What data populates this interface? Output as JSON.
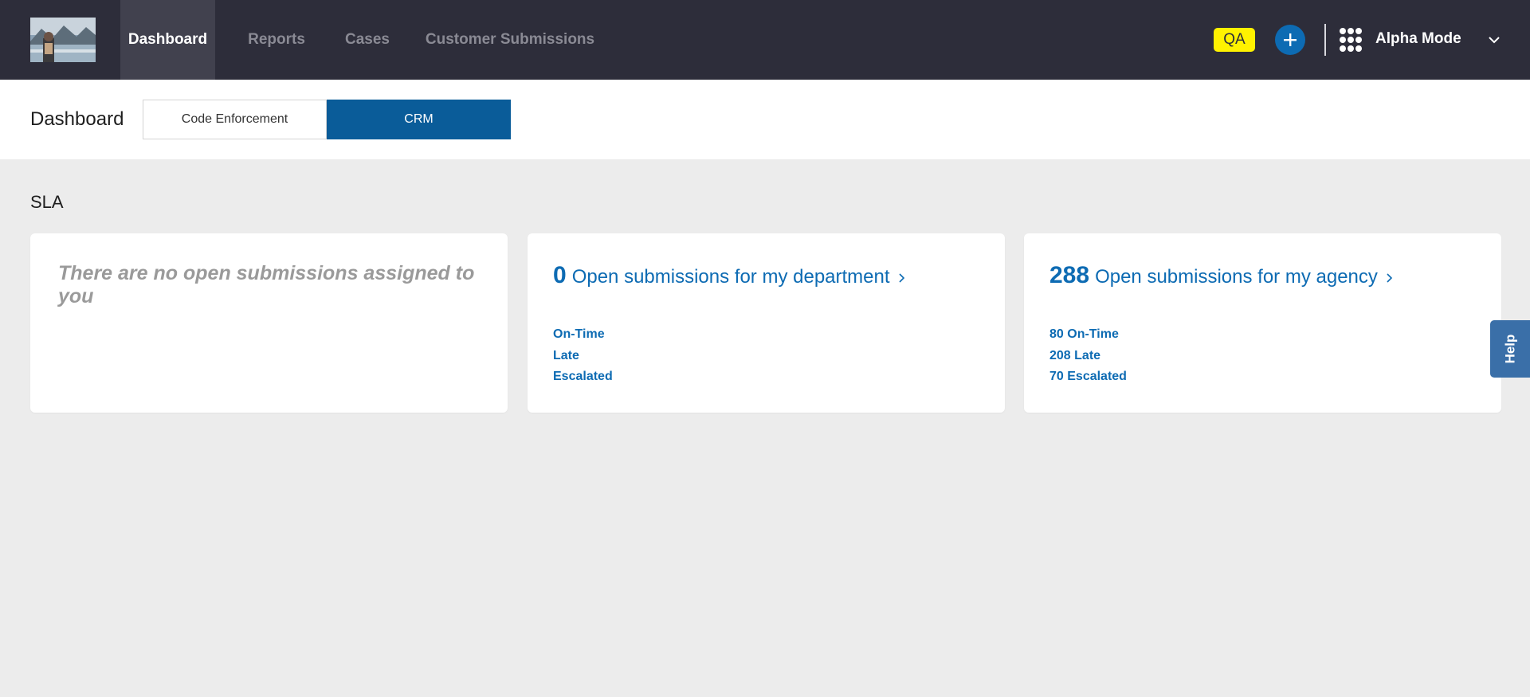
{
  "nav": {
    "tabs": [
      {
        "label": "Dashboard",
        "active": true
      },
      {
        "label": "Reports",
        "active": false
      },
      {
        "label": "Cases",
        "active": false
      },
      {
        "label": "Customer Submissions",
        "active": false
      }
    ],
    "env_badge": "QA",
    "account_name": "Alpha Mode",
    "icons": {
      "add": "plus-icon",
      "apps": "grid-icon",
      "account_menu": "chevron-down-icon"
    }
  },
  "subheader": {
    "title": "Dashboard",
    "toggle": [
      {
        "label": "Code Enforcement",
        "active": false
      },
      {
        "label": "CRM",
        "active": true
      }
    ]
  },
  "sla": {
    "title": "SLA",
    "my_card": {
      "empty_message": "There are no open submissions assigned to you"
    },
    "department_card": {
      "count": "0",
      "label": "Open submissions for my department",
      "stats": [
        "On-Time",
        "Late",
        "Escalated"
      ]
    },
    "agency_card": {
      "count": "288",
      "label": "Open submissions for my agency",
      "stats": [
        "80 On-Time",
        "208 Late",
        "70 Escalated"
      ]
    }
  },
  "help_label": "Help",
  "colors": {
    "topbar": "#2d2d3a",
    "accent": "#0d6bb3",
    "active_toggle": "#0a5c99",
    "qa_badge": "#fff200",
    "help_tab": "#3a6fa8",
    "background": "#ececec"
  }
}
